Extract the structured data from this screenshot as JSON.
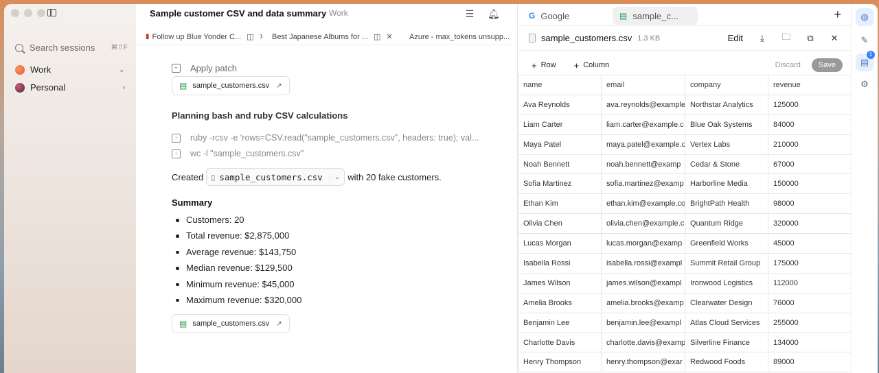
{
  "sidebar": {
    "search_label": "Search sessions",
    "search_shortcut": "⌘⇧F",
    "sessions": [
      {
        "label": "Work",
        "color": "#e8563a"
      },
      {
        "label": "Personal",
        "color": "#8a3b5a"
      }
    ]
  },
  "chat": {
    "title": "Sample customer CSV and data summary",
    "tag": "Work",
    "tabs": [
      {
        "label": "Follow up Blue Yonder C..."
      },
      {
        "label": "Best Japanese Albums for ..."
      },
      {
        "label": "Azure - max_tokens unsupp..."
      }
    ],
    "apply_patch": "Apply patch",
    "file_chip": "sample_customers.csv",
    "planning_heading": "Planning bash and ruby CSV calculations",
    "commands": [
      "ruby -rcsv -e 'rows=CSV.read(\"sample_customers.csv\", headers: true); val...",
      "wc -l \"sample_customers.csv\""
    ],
    "created_prefix": "Created",
    "created_file": "sample_customers.csv",
    "created_suffix": "with 20 fake customers.",
    "summary_heading": "Summary",
    "summary": [
      "Customers: 20",
      "Total revenue: $2,875,000",
      "Average revenue: $143,750",
      "Median revenue: $129,500",
      "Minimum revenue: $45,000",
      "Maximum revenue: $320,000"
    ],
    "file_chip_bottom": "sample_customers.csv"
  },
  "browser": {
    "tab_google": "Google",
    "tab_file": "sample_c..."
  },
  "csv": {
    "file_name": "sample_customers.csv",
    "file_size": "1.3 KB",
    "edit_label": "Edit",
    "add_row": "Row",
    "add_column": "Column",
    "discard": "Discard",
    "save": "Save",
    "headers": [
      "name",
      "email",
      "company",
      "revenue"
    ],
    "rows": [
      [
        "Ava Reynolds",
        "ava.reynolds@example",
        "Northstar Analytics",
        "125000"
      ],
      [
        "Liam Carter",
        "liam.carter@example.c",
        "Blue Oak Systems",
        "84000"
      ],
      [
        "Maya Patel",
        "maya.patel@example.c",
        "Vertex Labs",
        "210000"
      ],
      [
        "Noah Bennett",
        "noah.bennett@examp",
        "Cedar & Stone",
        "67000"
      ],
      [
        "Sofia Martinez",
        "sofia.martinez@examp",
        "Harborline Media",
        "150000"
      ],
      [
        "Ethan Kim",
        "ethan.kim@example.co",
        "BrightPath Health",
        "98000"
      ],
      [
        "Olivia Chen",
        "olivia.chen@example.c",
        "Quantum Ridge",
        "320000"
      ],
      [
        "Lucas Morgan",
        "lucas.morgan@examp",
        "Greenfield Works",
        "45000"
      ],
      [
        "Isabella Rossi",
        "isabella.rossi@exampl",
        "Summit Retail Group",
        "175000"
      ],
      [
        "James Wilson",
        "james.wilson@exampl",
        "Ironwood Logistics",
        "112000"
      ],
      [
        "Amelia Brooks",
        "amelia.brooks@examp",
        "Clearwater Design",
        "76000"
      ],
      [
        "Benjamin Lee",
        "benjamin.lee@exampl",
        "Atlas Cloud Services",
        "255000"
      ],
      [
        "Charlotte Davis",
        "charlotte.davis@examp",
        "Silverline Finance",
        "134000"
      ],
      [
        "Henry Thompson",
        "henry.thompson@exar",
        "Redwood Foods",
        "89000"
      ]
    ]
  },
  "rail": {
    "badge_count": "1"
  }
}
